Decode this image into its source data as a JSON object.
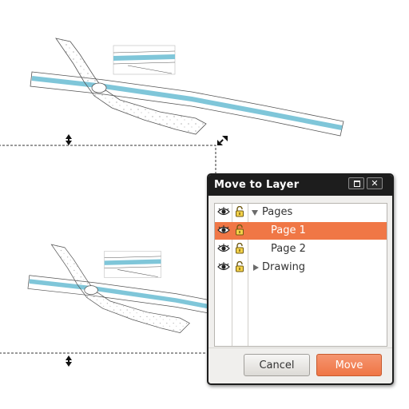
{
  "dialog": {
    "title": "Move to Layer",
    "maximize_icon": "maximize-icon",
    "close_icon": "close-icon"
  },
  "layers": [
    {
      "label": "Pages",
      "expander": "expanded",
      "selected": false,
      "visible_icon": "eye-icon",
      "lock_icon": "unlocked-icon"
    },
    {
      "label": "Page 1",
      "expander": "none",
      "selected": true,
      "visible_icon": "eye-icon",
      "lock_icon": "unlocked-icon"
    },
    {
      "label": "Page 2",
      "expander": "none",
      "selected": false,
      "visible_icon": "eye-icon",
      "lock_icon": "unlocked-icon"
    },
    {
      "label": "Drawing",
      "expander": "collapsed",
      "selected": false,
      "visible_icon": "eye-icon",
      "lock_icon": "unlocked-icon"
    }
  ],
  "buttons": {
    "cancel_label": "Cancel",
    "move_label": "Move"
  },
  "colors": {
    "selection": "#f07746",
    "titlebar": "#1d1d1d",
    "river": "#7fc6d9"
  }
}
